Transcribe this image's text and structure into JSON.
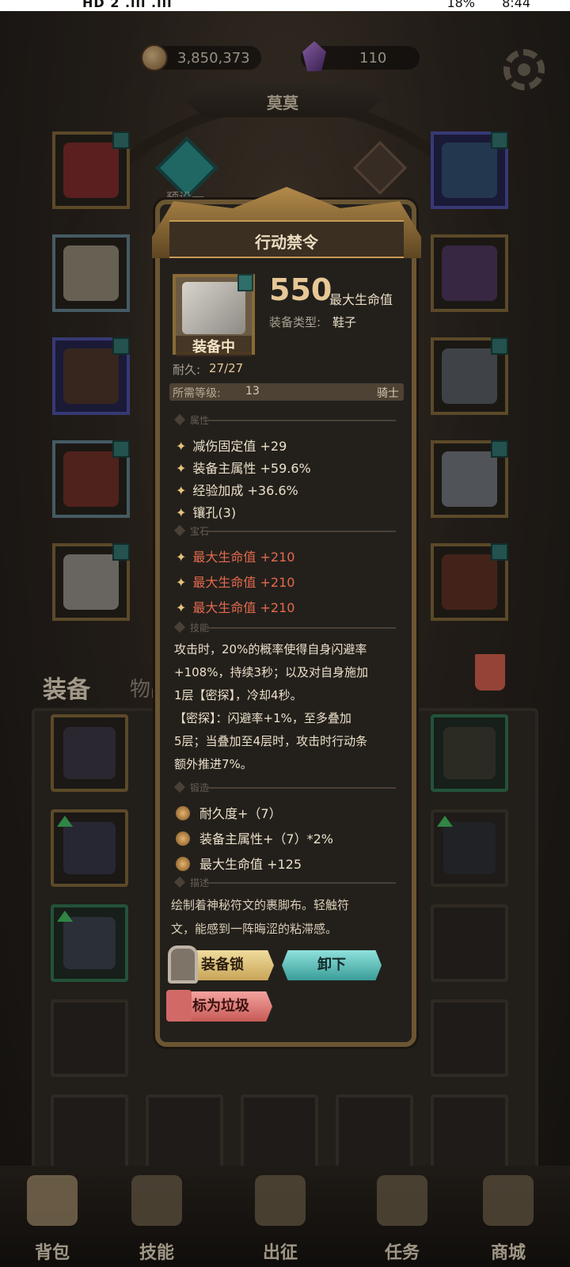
{
  "status_bar": {
    "left": "HD 2 .ıll .ıll",
    "battery": "18%",
    "time": "8:44"
  },
  "currency": {
    "gold": "3,850,373",
    "gems": "110"
  },
  "character": {
    "name": "莫莫",
    "preset_label": "预设一"
  },
  "inventory_tabs": {
    "equip": "装备",
    "items": "物品"
  },
  "tooltip": {
    "title": "行动禁令",
    "equipped_label": "装备中",
    "main_value": "550",
    "main_stat": "最大生命值",
    "type_label": "装备类型:",
    "type_value": "鞋子",
    "durability_label": "耐久:",
    "durability_value": "27/27",
    "requirement_label": "所需等级:",
    "requirement_level": "13",
    "requirement_class": "骑士",
    "sections": {
      "attributes": "属性",
      "gems": "宝石",
      "skill": "技能",
      "forge": "锻造",
      "description": "描述"
    },
    "attributes": [
      "减伤固定值 +29",
      "装备主属性 +59.6%",
      "经验加成 +36.6%",
      "镶孔(3)"
    ],
    "gems": [
      "最大生命值 +210",
      "最大生命值 +210",
      "最大生命值 +210"
    ],
    "skill_lines": [
      "攻击时，20%的概率使得自身闪避率",
      "+108%，持续3秒；以及对自身施加",
      "1层【密探】，冷却4秒。",
      "【密探】：闪避率+1%，至多叠加",
      "5层；当叠加至4层时，攻击时行动条",
      "额外推进7%。"
    ],
    "forge": [
      "耐久度+（7）",
      "装备主属性+（7）*2%",
      "最大生命值 +125"
    ],
    "description_lines": [
      "绘制着神秘符文的裹脚布。轻触符",
      "文，能感到一阵晦涩的粘滞感。"
    ],
    "buttons": {
      "lock": "装备锁",
      "unequip": "卸下",
      "mark_trash": "标为垃圾"
    }
  },
  "bottom_nav": [
    {
      "label": "背包"
    },
    {
      "label": "技能"
    },
    {
      "label": "出征"
    },
    {
      "label": "任务"
    },
    {
      "label": "商城"
    }
  ],
  "colors": {
    "gold_text": "#e7c896",
    "gem_red": "#e46a4e",
    "panel": "#23201c",
    "frame": "#6b5633"
  }
}
